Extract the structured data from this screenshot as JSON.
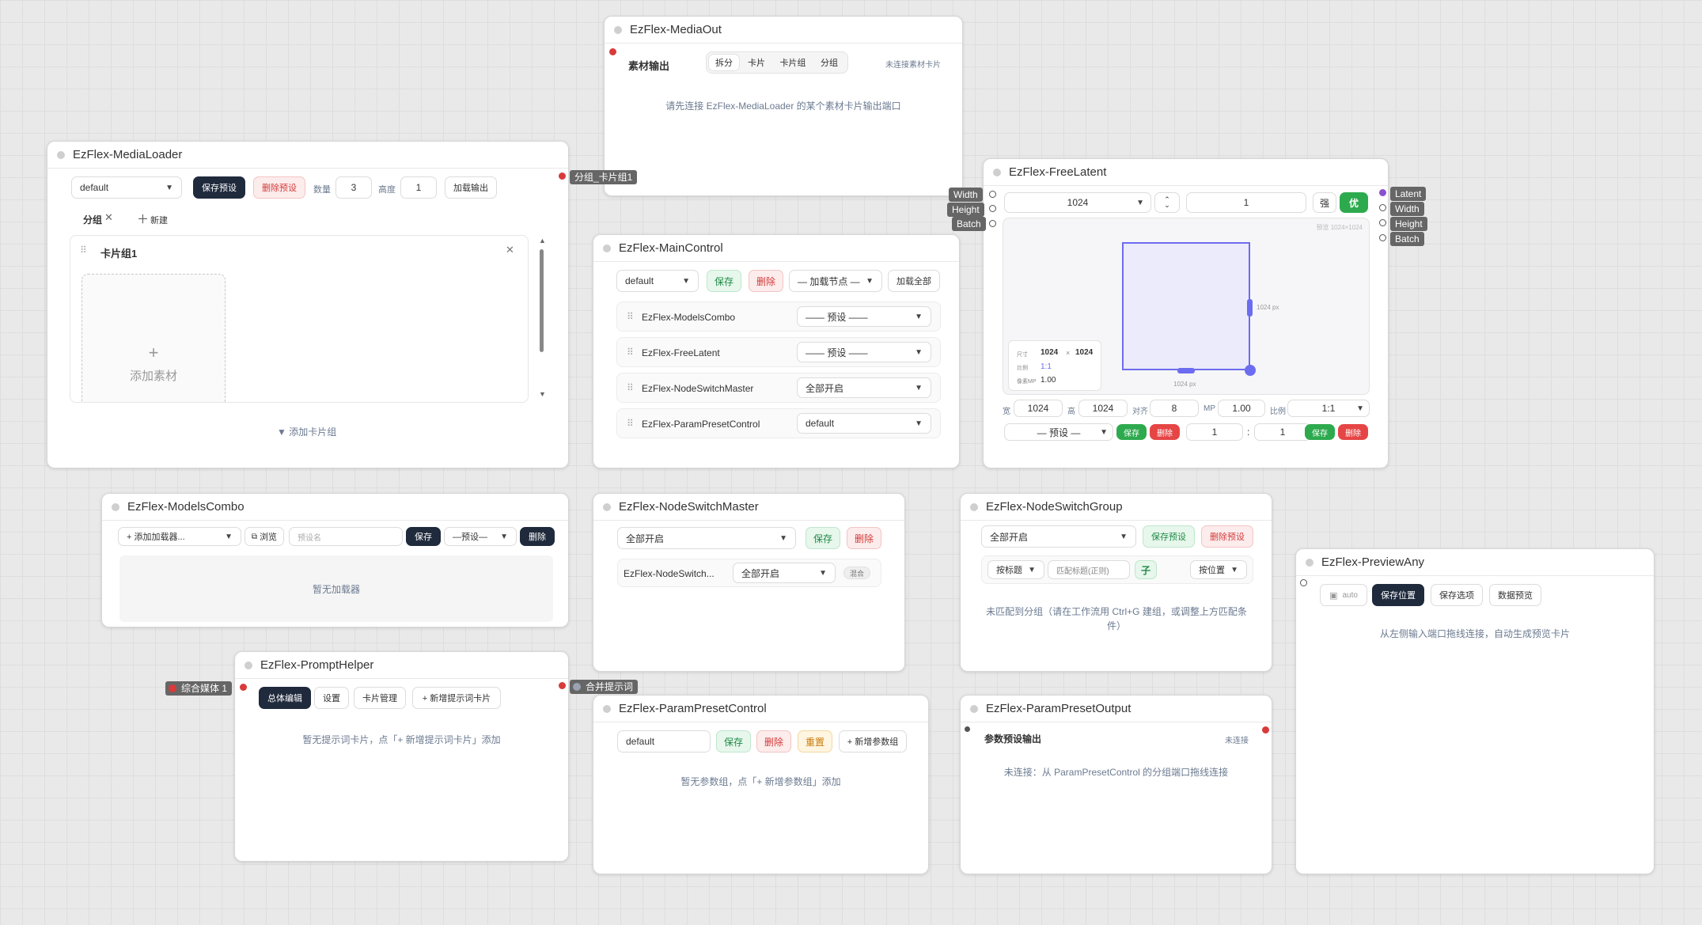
{
  "media_out": {
    "title": "EzFlex-MediaOut",
    "section": "素材输出",
    "tabs": [
      "拆分",
      "卡片",
      "卡片组",
      "分组"
    ],
    "status": "未连接素材卡片",
    "hint": "请先连接 EzFlex-MediaLoader 的某个素材卡片输出端口"
  },
  "media_loader": {
    "title": "EzFlex-MediaLoader",
    "preset": "default",
    "save_preset": "保存预设",
    "delete_preset": "删除预设",
    "count_label": "数量",
    "count": "3",
    "height_label": "高度",
    "height": "1",
    "load_output": "加载输出",
    "group_tab": "分组",
    "new_label": "新建",
    "card_group": "卡片组1",
    "add_material": "添加素材",
    "add_card_group": "▼ 添加卡片组",
    "output_port": "分组_卡片组1"
  },
  "free_latent": {
    "title": "EzFlex-FreeLatent",
    "width_select": "1024",
    "batch": "1",
    "strong": "强",
    "opt": "优",
    "preview_caption": "预览 1024×1024",
    "size_label": "尺寸",
    "size_w": "1024",
    "size_x": "×",
    "size_h": "1024",
    "ratio_label": "比例",
    "ratio": "1:1",
    "mp_label": "像素MP",
    "mp": "1.00",
    "right_px": "1024 px",
    "bottom_px": "1024 px",
    "w_label": "宽",
    "w": "1024",
    "h_label": "高",
    "h": "1024",
    "align_label": "对齐",
    "align": "8",
    "mp2_label": "MP",
    "mp2": "1.00",
    "ratio2_label": "比例",
    "ratio2": "1:1",
    "preset": "— 预设 —",
    "save": "保存",
    "delete": "删除",
    "r1": "1",
    "colon": ":",
    "r2": "1",
    "inputs": [
      "Width",
      "Height",
      "Batch"
    ],
    "outputs": [
      "Latent",
      "Width",
      "Height",
      "Batch"
    ]
  },
  "main_control": {
    "title": "EzFlex-MainControl",
    "preset": "default",
    "save": "保存",
    "delete": "删除",
    "load_node": "— 加载节点 —",
    "load_all": "加载全部",
    "rows": [
      {
        "name": "EzFlex-ModelsCombo",
        "value": "—— 预设 ——"
      },
      {
        "name": "EzFlex-FreeLatent",
        "value": "—— 预设 ——"
      },
      {
        "name": "EzFlex-NodeSwitchMaster",
        "value": "全部开启"
      },
      {
        "name": "EzFlex-ParamPresetControl",
        "value": "default"
      }
    ]
  },
  "models_combo": {
    "title": "EzFlex-ModelsCombo",
    "add_loader": "+ 添加加载器...",
    "browse": "浏览",
    "preset_placeholder": "预设名",
    "save": "保存",
    "preset_select": "—预设—",
    "delete": "删除",
    "empty": "暂无加载器"
  },
  "node_switch_master": {
    "title": "EzFlex-NodeSwitchMaster",
    "mode": "全部开启",
    "save": "保存",
    "delete": "删除",
    "row_name": "EzFlex-NodeSwitch...",
    "row_value": "全部开启",
    "row_badge": "混合"
  },
  "node_switch_group": {
    "title": "EzFlex-NodeSwitchGroup",
    "mode": "全部开启",
    "save_preset": "保存预设",
    "delete_preset": "删除预设",
    "by_title": "按标题",
    "match_placeholder": "匹配标题(正则)",
    "sub": "子",
    "by_position": "按位置",
    "hint": "未匹配到分组（请在工作流用 Ctrl+G 建组，或调整上方匹配条件）"
  },
  "preview_any": {
    "title": "EzFlex-PreviewAny",
    "auto": "auto",
    "save_position": "保存位置",
    "save_options": "保存选项",
    "data_preview": "数据预览",
    "hint": "从左侧输入端口拖线连接，自动生成预览卡片"
  },
  "prompt_helper": {
    "title": "EzFlex-PromptHelper",
    "tabs": [
      "总体编辑",
      "设置",
      "卡片管理",
      "+ 新增提示词卡片"
    ],
    "hint": "暂无提示词卡片，点「+ 新增提示词卡片」添加",
    "input_port": "综合媒体 1",
    "output_port": "合并提示词"
  },
  "param_preset_control": {
    "title": "EzFlex-ParamPresetControl",
    "preset": "default",
    "save": "保存",
    "delete": "删除",
    "reset": "重置",
    "add_group": "+ 新增参数组",
    "hint": "暂无参数组，点「+ 新增参数组」添加"
  },
  "param_preset_output": {
    "title": "EzFlex-ParamPresetOutput",
    "section": "参数预设输出",
    "status": "未连接",
    "hint": "未连接：从 ParamPresetControl 的分组端口拖线连接"
  }
}
